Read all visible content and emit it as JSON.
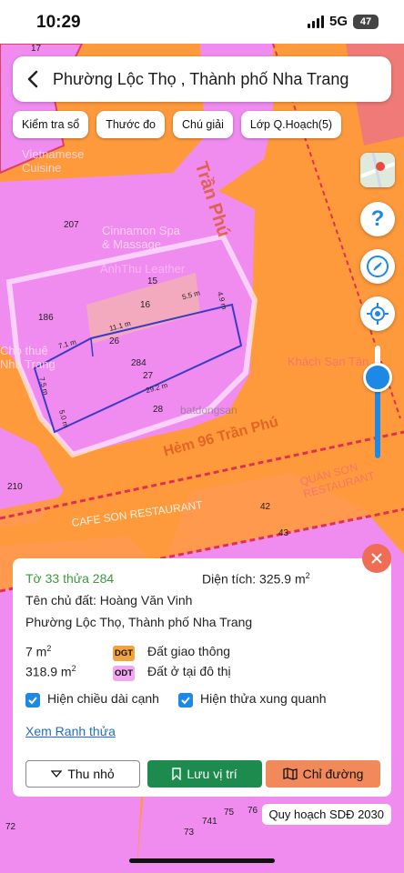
{
  "status": {
    "time": "10:29",
    "network": "5G",
    "battery": "47"
  },
  "header": {
    "title": "Phường Lộc Thọ , Thành phố Nha Trang"
  },
  "toolbar": [
    "Kiểm tra sổ",
    "Thước đo",
    "Chú giải",
    "Lớp Q.Hoạch(5)"
  ],
  "map": {
    "streets": [
      "Trần Phú",
      "Hẻm 96 Trần Phú"
    ],
    "plot_numbers": [
      "17",
      "207",
      "15",
      "16",
      "186",
      "26",
      "284",
      "27",
      "28",
      "210",
      "42",
      "43",
      "76",
      "75",
      "741",
      "72",
      "73"
    ],
    "edge_lengths": [
      "5.5 m",
      "4.9 m",
      "11.1 m",
      "7.1 m",
      "7.5 m",
      "29.2 m",
      "5.0 m"
    ],
    "poi": [
      "Cinnamon Spa & Massage",
      "AnhThu Leather",
      "Khách Sạn Tân",
      "QUÁN SƠN RESTAURANT",
      "CAFE SON RESTAURANT",
      "Vietnamese Cuisine",
      "Cho thuê Nha Trang"
    ],
    "watermark": "batdongsan"
  },
  "info": {
    "plot_ref": "Tờ 33 thửa 284",
    "area_label": "Diện tích: 325.9 m",
    "area_sup": "2",
    "owner": "Tên chủ đất: Hoàng Văn Vinh",
    "address": "Phường Lộc Thọ, Thành phố Nha Trang",
    "landuse": [
      {
        "area": "7 m",
        "sup": "2",
        "code": "DGT",
        "label": "Đất giao thông",
        "color": "#f4a23c"
      },
      {
        "area": "318.9 m",
        "sup": "2",
        "code": "ODT",
        "label": "Đất ở tại đô thị",
        "color": "#f3a7f2"
      }
    ],
    "check_edges": "Hiện chiều dài cạnh",
    "check_neighbors": "Hiện thửa xung quanh",
    "boundary_link": "Xem Ranh thửa"
  },
  "actions": {
    "collapse": "Thu nhỏ",
    "save": "Lưu vị trí",
    "directions": "Chỉ đường"
  },
  "footer": {
    "plan": "Quy hoạch SDĐ 2030"
  },
  "zoom_level": 0.72
}
